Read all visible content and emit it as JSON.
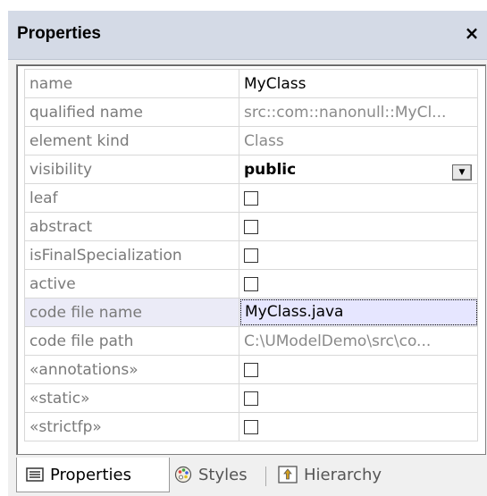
{
  "panel": {
    "title": "Properties",
    "close_glyph": "×"
  },
  "rows": [
    {
      "name": "name",
      "value": "MyClass",
      "type": "text-dark"
    },
    {
      "name": "qualified name",
      "value": "src::com::nanonull::MyCl...",
      "type": "text"
    },
    {
      "name": "element kind",
      "value": "Class",
      "type": "text"
    },
    {
      "name": "visibility",
      "value": "public",
      "type": "dropdown"
    },
    {
      "name": "leaf",
      "value": false,
      "type": "checkbox"
    },
    {
      "name": "abstract",
      "value": false,
      "type": "checkbox"
    },
    {
      "name": "isFinalSpecialization",
      "value": false,
      "type": "checkbox"
    },
    {
      "name": "active",
      "value": false,
      "type": "checkbox"
    },
    {
      "name": "code file name",
      "value": "MyClass.java",
      "type": "editing"
    },
    {
      "name": "code file path",
      "value": "C:\\UModelDemo\\src\\co...",
      "type": "text"
    },
    {
      "name": "«annotations»",
      "value": false,
      "type": "checkbox"
    },
    {
      "name": "«static»",
      "value": false,
      "type": "checkbox"
    },
    {
      "name": "«strictfp»",
      "value": false,
      "type": "checkbox"
    }
  ],
  "tabs": [
    {
      "label": "Properties",
      "icon": "properties-icon",
      "active": true
    },
    {
      "label": "Styles",
      "icon": "palette-icon",
      "active": false
    },
    {
      "label": "Hierarchy",
      "icon": "hierarchy-icon",
      "active": false
    }
  ]
}
